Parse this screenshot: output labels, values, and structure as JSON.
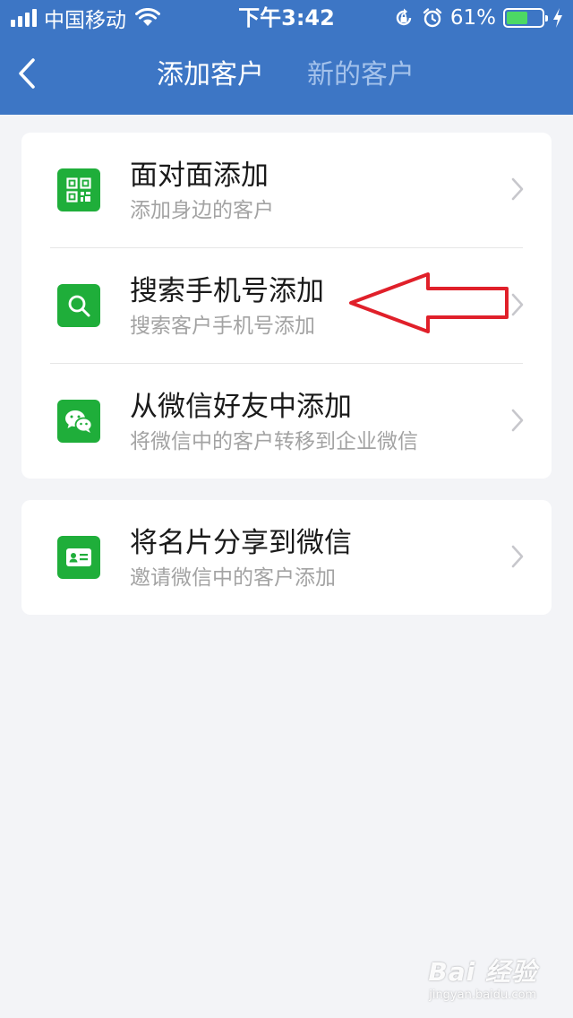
{
  "status_bar": {
    "carrier": "中国移动",
    "time": "下午3:42",
    "battery_percent_label": "61%",
    "battery_level": 0.61
  },
  "nav": {
    "tab_active": "添加客户",
    "tab_inactive": "新的客户"
  },
  "options": [
    {
      "title": "面对面添加",
      "subtitle": "添加身边的客户",
      "icon": "qr-code-icon"
    },
    {
      "title": "搜索手机号添加",
      "subtitle": "搜索客户手机号添加",
      "icon": "search-icon"
    },
    {
      "title": "从微信好友中添加",
      "subtitle": "将微信中的客户转移到企业微信",
      "icon": "wechat-icon"
    }
  ],
  "share_option": {
    "title": "将名片分享到微信",
    "subtitle": "邀请微信中的客户添加",
    "icon": "business-card-icon"
  },
  "watermark": {
    "logo": "Bai 经验",
    "site": "jingyan.baidu.com"
  },
  "colors": {
    "header_bg": "#3d76c5",
    "icon_green": "#1fae3a",
    "page_bg": "#f3f4f7",
    "annotation_red": "#e0202a"
  }
}
